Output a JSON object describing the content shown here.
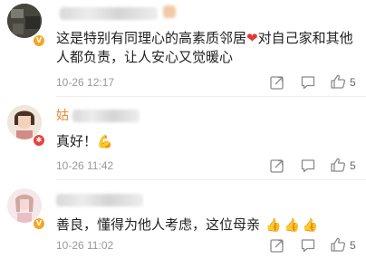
{
  "comments": [
    {
      "text_before_heart": "这是特别有同理心的高素质邻居",
      "heart_glyph": "❤",
      "text_after_heart": "对自己家和其他人都负责，让人安心又觉暖心",
      "timestamp": "10-26 12:17",
      "like_count": "5",
      "badge_color": "#f5a623"
    },
    {
      "name_first_char": "姑",
      "text": "真好！",
      "emoji": "💪",
      "timestamp": "10-26 11:42",
      "like_count": "5",
      "badge_color": "#e64340"
    },
    {
      "text": "善良，懂得为他人考虑，这位母亲",
      "emoji": "👍👍👍",
      "timestamp": "10-26 11:02",
      "like_count": "5",
      "badge_color": "#f5a623"
    }
  ],
  "icons": {
    "share": "share-icon",
    "comment": "comment-icon",
    "like": "thumbs-up-icon"
  }
}
